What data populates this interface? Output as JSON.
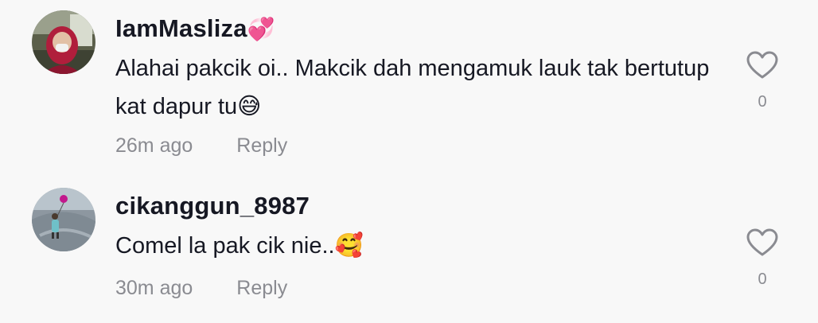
{
  "comments": [
    {
      "username": "IamMasliza",
      "username_emoji": "💞",
      "text": "Alahai pakcik oi.. Makcik dah mengamuk lauk tak bertutup kat dapur tu😅",
      "time": "26m ago",
      "reply_label": "Reply",
      "like_count": "0",
      "icon": "heart-outline-icon"
    },
    {
      "username": "cikanggun_8987",
      "username_emoji": "",
      "text": "Comel la pak cik nie..🥰",
      "time": "30m ago",
      "reply_label": "Reply",
      "like_count": "0",
      "icon": "heart-outline-icon"
    }
  ],
  "colors": {
    "background": "#f8f8f8",
    "text_primary": "#161823",
    "text_secondary": "#8a8b91"
  }
}
